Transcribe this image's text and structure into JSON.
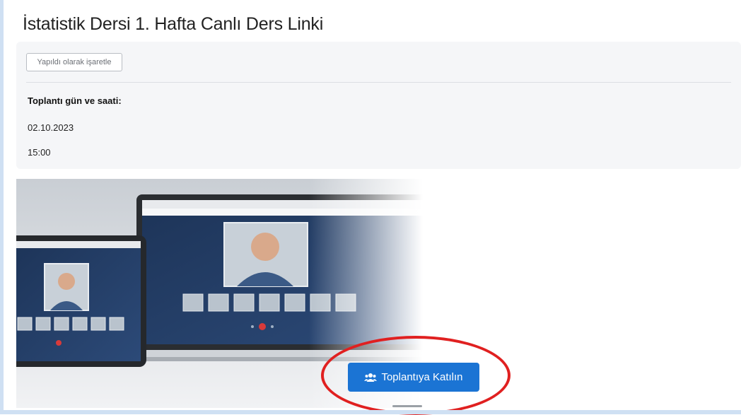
{
  "page": {
    "title": "İstatistik Dersi 1. Hafta Canlı Ders Linki"
  },
  "activity": {
    "mark_done_label": "Yapıldı olarak işaretle",
    "meeting_label": "Toplantı gün ve saati:",
    "date": "02.10.2023",
    "time": "15:00"
  },
  "hero": {
    "icon": "video-conference-illustration"
  },
  "join": {
    "label": "Toplantıya Katılın",
    "icon": "users-icon"
  },
  "colors": {
    "accent": "#1b74d4",
    "annotation": "#e02020"
  }
}
